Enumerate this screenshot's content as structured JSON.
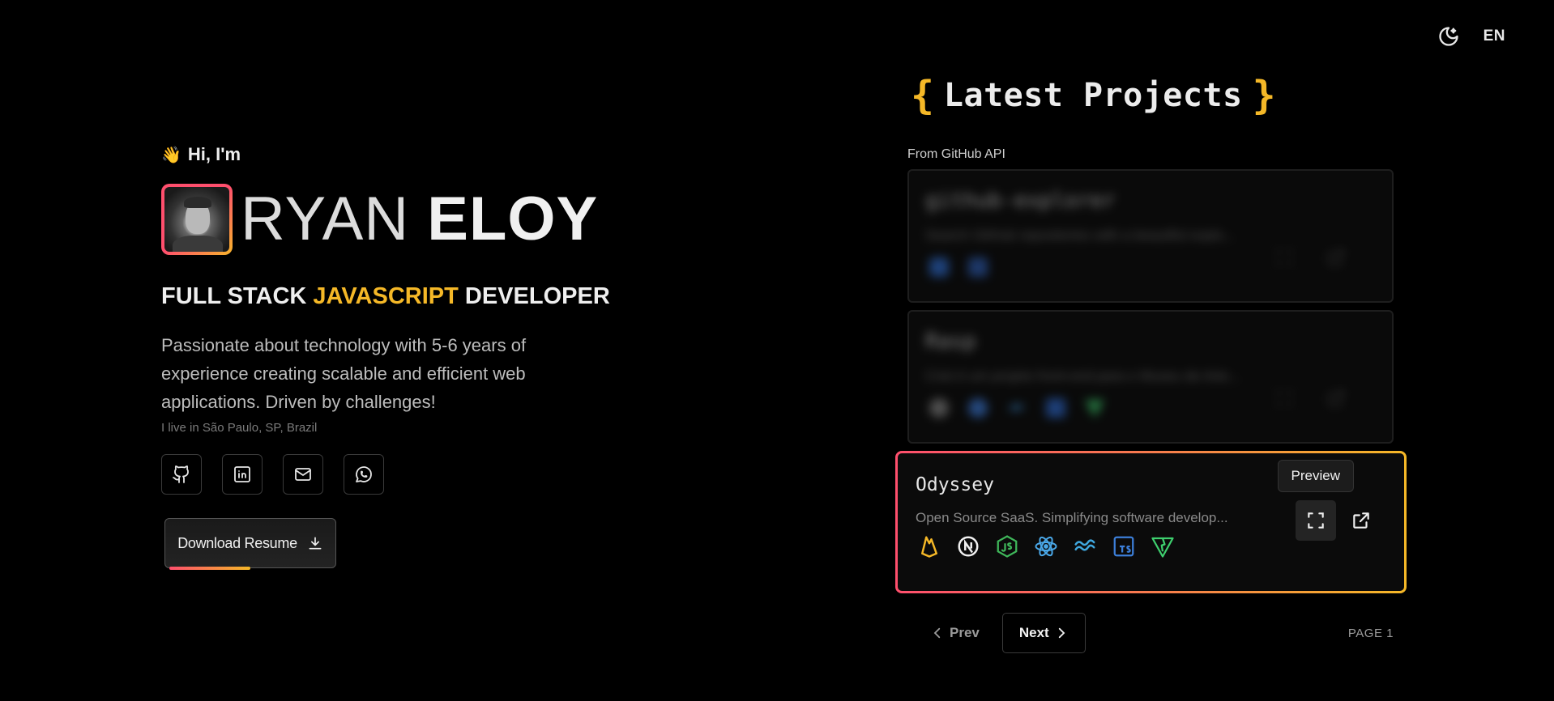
{
  "topbar": {
    "language": "EN",
    "theme_icon": "moon-stars-icon"
  },
  "hero": {
    "greeting": "Hi, I'm",
    "wave": "👋",
    "first_name": "RYAN",
    "last_name": "ELOY",
    "role_start": "FULL STACK",
    "role_accent": "JAVASCRIPT",
    "role_end": "DEVELOPER",
    "bio": "Passionate about technology with 5-6 years of experience creating scalable and efficient web applications. Driven by challenges!",
    "location": "I live in São Paulo, SP, Brazil",
    "socials": [
      "github-icon",
      "linkedin-icon",
      "mail-icon",
      "whatsapp-icon"
    ],
    "resume_label": "Download Resume",
    "accent_color": "#f5b827",
    "gradient_start": "#ff4f6d"
  },
  "projects": {
    "brace_open": "{",
    "brace_close": "}",
    "title": "Latest Projects",
    "source": "From GitHub API",
    "items": [
      {
        "name": "github-explorer",
        "description": "Search GitHub repositories with a beautiful explo...",
        "blurred": true
      },
      {
        "name": "Rasp",
        "description": "Criei é um projeto front-end para o Museu de Arte...",
        "blurred": true
      },
      {
        "name": "Odyssey",
        "description": "Open Source SaaS. Simplifying software develop...",
        "blurred": false
      }
    ],
    "tooltip": "Preview",
    "prev_label": "Prev",
    "next_label": "Next",
    "page_label": "PAGE 1"
  }
}
